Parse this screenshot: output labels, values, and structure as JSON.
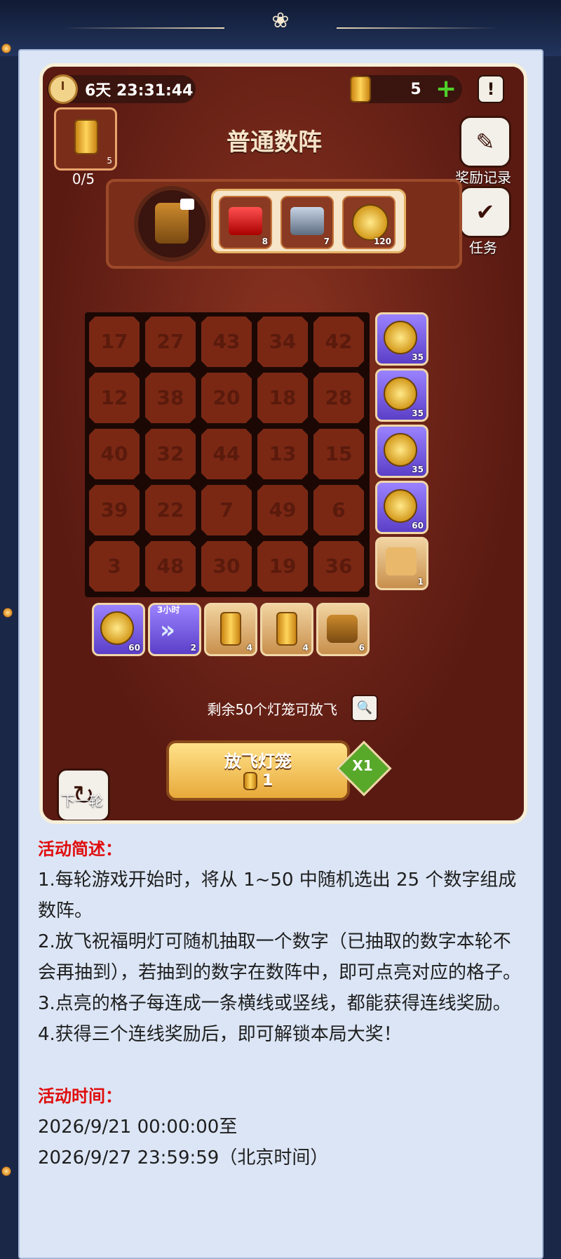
{
  "header": {
    "timer": "6天 23:31:44",
    "lantern_count": "5"
  },
  "board": {
    "title": "普通数阵",
    "progress": "0/5",
    "progress_lanterns": "5",
    "reward_record_label": "奖励记录",
    "task_label": "任务",
    "grand_prize_items": [
      {
        "icon": "ruby-chest",
        "count": "8"
      },
      {
        "icon": "silver-chest",
        "count": "7"
      },
      {
        "icon": "gold-coin",
        "count": "120"
      }
    ],
    "numbers": [
      [
        "17",
        "27",
        "43",
        "34",
        "42"
      ],
      [
        "12",
        "38",
        "20",
        "18",
        "28"
      ],
      [
        "40",
        "32",
        "44",
        "13",
        "15"
      ],
      [
        "39",
        "22",
        "7",
        "49",
        "6"
      ],
      [
        "3",
        "48",
        "30",
        "19",
        "36"
      ]
    ],
    "row_rewards": [
      {
        "icon": "gold-coin",
        "count": "35"
      },
      {
        "icon": "gold-coin",
        "count": "35"
      },
      {
        "icon": "gold-coin",
        "count": "35"
      },
      {
        "icon": "gold-coin",
        "count": "60"
      },
      {
        "icon": "puzzle-piece",
        "count": "1"
      }
    ],
    "column_rewards": [
      {
        "icon": "gold-coin",
        "count": "60"
      },
      {
        "icon": "speed-up",
        "count": "2",
        "tag": "3小时"
      },
      {
        "icon": "lantern",
        "count": "4"
      },
      {
        "icon": "lantern",
        "count": "4"
      },
      {
        "icon": "gold-chest",
        "count": "6"
      }
    ],
    "remaining": "剩余50个灯笼可放飞",
    "next_round_label": "下一轮",
    "release_label": "放飞灯笼",
    "release_cost": "1",
    "multiplier": "X1"
  },
  "description": {
    "summary_title": "活动简述：",
    "rules": [
      "1.每轮游戏开始时，将从 1~50 中随机选出 25 个数字组成数阵。",
      "2.放飞祝福明灯可随机抽取一个数字（已抽取的数字本轮不会再抽到），若抽到的数字在数阵中，即可点亮对应的格子。",
      "3.点亮的格子每连成一条横线或竖线，都能获得连线奖励。",
      "4.获得三个连线奖励后，即可解锁本局大奖！"
    ],
    "time_title": "活动时间：",
    "start": "2026/9/21 00:00:00至",
    "end": "2026/9/27 23:59:59（北京时间）"
  }
}
